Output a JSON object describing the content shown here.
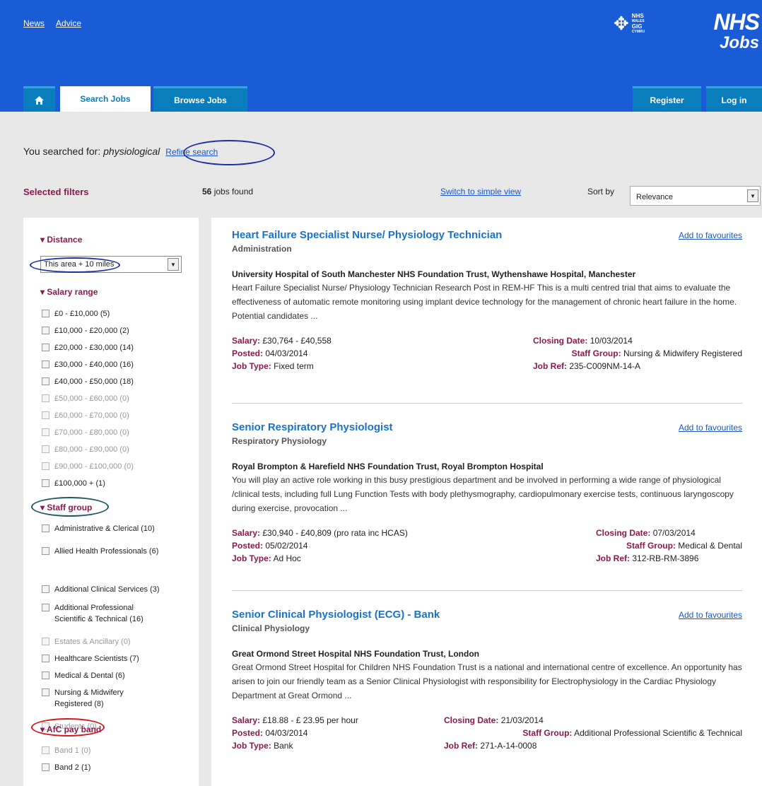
{
  "header": {
    "top_links": [
      "News",
      "Advice"
    ],
    "welsh_logo_text": [
      "NHS",
      "WALES",
      "GIG",
      "CYMRU"
    ],
    "nhs_logo": "NHS",
    "jobs_logo": "Jobs",
    "tabs": {
      "search": "Search Jobs",
      "browse": "Browse Jobs",
      "register": "Register",
      "login": "Log in"
    }
  },
  "search": {
    "prefix": "You searched for: ",
    "term": "physiological",
    "refine": "Refine search"
  },
  "filters": {
    "title": "Selected filters",
    "distance": {
      "heading": "Distance",
      "selected": "This area + 10 miles"
    },
    "salary": {
      "heading": "Salary range",
      "options": [
        {
          "label": "£0 - £10,000",
          "count": "(5)",
          "enabled": true
        },
        {
          "label": "£10,000 - £20,000",
          "count": "(2)",
          "enabled": true
        },
        {
          "label": "£20,000 - £30,000",
          "count": "(14)",
          "enabled": true
        },
        {
          "label": "£30,000 - £40,000",
          "count": "(16)",
          "enabled": true
        },
        {
          "label": "£40,000 - £50,000",
          "count": "(18)",
          "enabled": true
        },
        {
          "label": "£50,000 - £60,000",
          "count": "(0)",
          "enabled": false
        },
        {
          "label": "£60,000 - £70,000",
          "count": "(0)",
          "enabled": false
        },
        {
          "label": "£70,000 - £80,000",
          "count": "(0)",
          "enabled": false
        },
        {
          "label": "£80,000 - £90,000",
          "count": "(0)",
          "enabled": false
        },
        {
          "label": "£90,000 - £100,000",
          "count": "(0)",
          "enabled": false
        },
        {
          "label": "£100,000 +",
          "count": "(1)",
          "enabled": true
        }
      ]
    },
    "staff": {
      "heading": "Staff group",
      "options": [
        {
          "label": "Administrative & Clerical",
          "count": "(10)",
          "enabled": true
        },
        {
          "label": "Allied Health Professionals",
          "count": "(6)",
          "enabled": true
        },
        {
          "label": "Additional Clinical Services",
          "count": "(3)",
          "enabled": true
        },
        {
          "label": "Additional Professional Scientific & Technical",
          "count": "(16)",
          "enabled": true
        },
        {
          "label": "Estates & Ancillary",
          "count": "(0)",
          "enabled": false
        },
        {
          "label": "Healthcare Scientists",
          "count": "(7)",
          "enabled": true
        },
        {
          "label": "Medical & Dental",
          "count": "(6)",
          "enabled": true
        },
        {
          "label": "Nursing & Midwifery Registered",
          "count": "(8)",
          "enabled": true
        },
        {
          "label": "Students",
          "count": "(0)",
          "enabled": false
        }
      ]
    },
    "afc": {
      "heading": "AfC pay band",
      "options": [
        {
          "label": "Band 1",
          "count": "(0)",
          "enabled": false
        },
        {
          "label": "Band 2",
          "count": "(1)",
          "enabled": true
        }
      ]
    }
  },
  "results": {
    "count": "56",
    "count_suffix": " jobs found",
    "switch_view": "Switch to simple view",
    "sort_label": "Sort by",
    "sort_value": "Relevance",
    "fav_label": "Add to favourites",
    "labels": {
      "salary": "Salary:",
      "posted": "Posted:",
      "job_type": "Job Type:",
      "closing": "Closing Date:",
      "staff_group": "Staff Group:",
      "job_ref": "Job Ref:"
    },
    "jobs": [
      {
        "title": "Heart Failure Specialist Nurse/ Physiology Technician",
        "subtitle": "Administration",
        "org": "University Hospital of South Manchester NHS Foundation Trust, Wythenshawe Hospital, Manchester",
        "desc": "Heart Failure Specialist Nurse/ Physiology Technician Research Post in REM-HF This is a multi centred trial that aims to evaluate the effectiveness of automatic remote monitoring using implant device technology for the management of chronic heart failure in the home. Potential candidates ...",
        "salary": "£30,764 - £40,558",
        "posted": "04/03/2014",
        "job_type": "Fixed term",
        "closing": "10/03/2014",
        "staff_group": "Nursing & Midwifery Registered",
        "job_ref": "235-C009NM-14-A"
      },
      {
        "title": "Senior Respiratory Physiologist",
        "subtitle": "Respiratory Physiology",
        "org": "Royal Brompton & Harefield NHS Foundation Trust, Royal Brompton Hospital",
        "desc": "You will play an active role working in this busy prestigious department and be involved in performing a wide range of physiological /clinical tests, including full Lung Function Tests with body plethysmography, cardiopulmonary exercise tests, continuous laryngoscopy during exercise, provocation ...",
        "salary": "£30,940 - £40,809 (pro rata inc HCAS)",
        "posted": "05/02/2014",
        "job_type": "Ad Hoc",
        "closing": "07/03/2014",
        "staff_group": "Medical & Dental",
        "job_ref": "312-RB-RM-3896"
      },
      {
        "title": "Senior Clinical Physiologist (ECG) - Bank",
        "subtitle": "Clinical Physiology",
        "org": "Great Ormond Street Hospital NHS Foundation Trust, London",
        "desc": "Great Ormond Street Hospital for Children NHS Foundation Trust is a national and international centre of excellence. An opportunity has arisen to join our friendly team as a Senior Clinical Physiologist with responsibility for Electrophysiology in the Cardiac Physiology Department at Great Ormond ...",
        "salary": "£18.88 - £ 23.95 per hour",
        "posted": "04/03/2014",
        "job_type": "Bank",
        "closing": "21/03/2014",
        "staff_group": "Additional Professional Scientific & Technical",
        "job_ref": "271-A-14-0008"
      }
    ]
  }
}
